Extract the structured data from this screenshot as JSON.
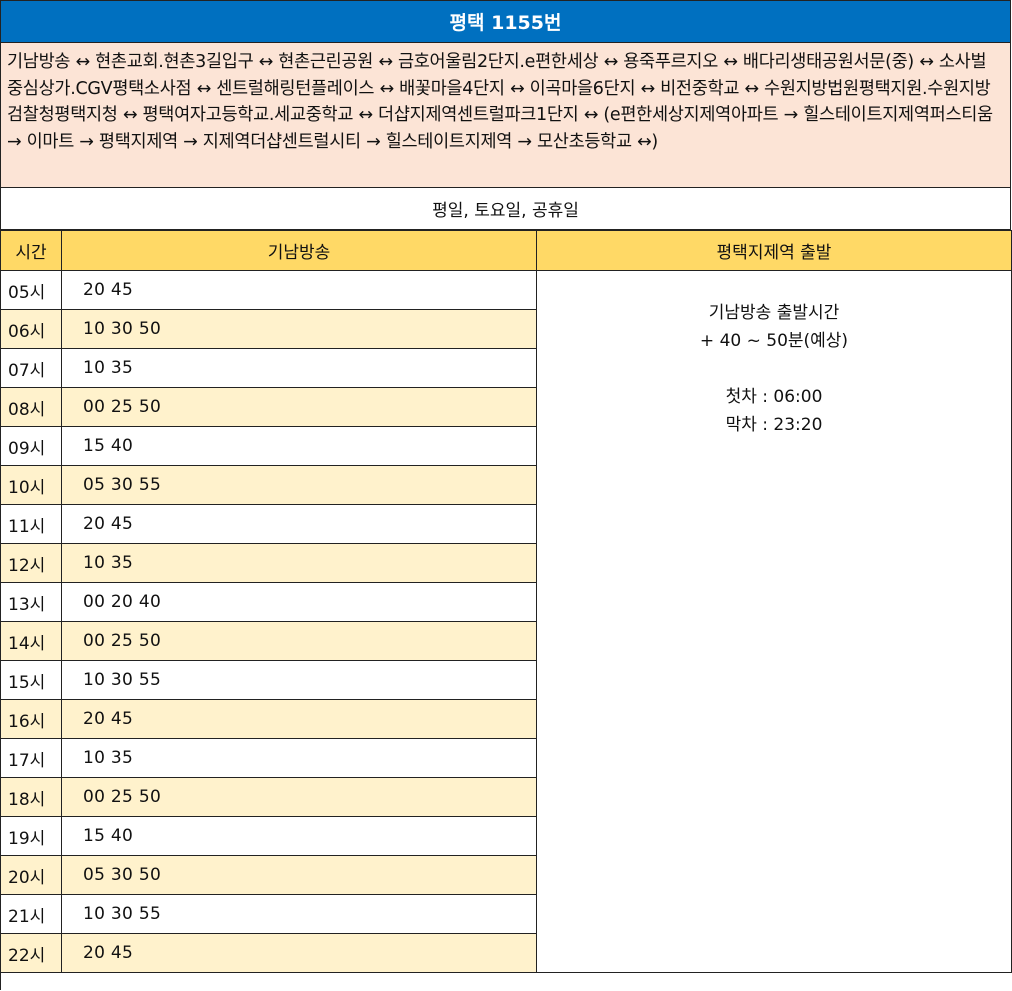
{
  "title": "평택 1155번",
  "route": "기남방송 ↔ 현촌교회.현촌3길입구 ↔ 현촌근린공원 ↔ 금호어울림2단지.e편한세상 ↔ 용죽푸르지오 ↔ 배다리생태공원서문(중) ↔ 소사벌중심상가.CGV평택소사점 ↔ 센트럴해링턴플레이스 ↔ 배꽃마을4단지 ↔ 이곡마을6단지 ↔ 비전중학교 ↔ 수원지방법원평택지원.수원지방검찰청평택지청 ↔ 평택여자고등학교.세교중학교 ↔ 더샵지제역센트럴파크1단지 ↔ (e편한세상지제역아파트 → 힐스테이트지제역퍼스티움 → 이마트 → 평택지제역 → 지제역더샵센트럴시티 → 힐스테이트지제역 → 모산초등학교 ↔)",
  "days": "평일, 토요일, 공휴일",
  "headers": {
    "hour": "시간",
    "origin": "기남방송",
    "return": "평택지제역 출발"
  },
  "rows": [
    {
      "hour": "05시",
      "mins": "20 45"
    },
    {
      "hour": "06시",
      "mins": "10 30 50"
    },
    {
      "hour": "07시",
      "mins": "10 35"
    },
    {
      "hour": "08시",
      "mins": "00 25 50"
    },
    {
      "hour": "09시",
      "mins": "15 40"
    },
    {
      "hour": "10시",
      "mins": "05 30 55"
    },
    {
      "hour": "11시",
      "mins": "20 45"
    },
    {
      "hour": "12시",
      "mins": "10 35"
    },
    {
      "hour": "13시",
      "mins": "00 20 40"
    },
    {
      "hour": "14시",
      "mins": "00 25 50"
    },
    {
      "hour": "15시",
      "mins": "10 30 55"
    },
    {
      "hour": "16시",
      "mins": "20 45"
    },
    {
      "hour": "17시",
      "mins": "10 35"
    },
    {
      "hour": "18시",
      "mins": "00 25 50"
    },
    {
      "hour": "19시",
      "mins": "15 40"
    },
    {
      "hour": "20시",
      "mins": "05 30 50"
    },
    {
      "hour": "21시",
      "mins": "10 30 55"
    },
    {
      "hour": "22시",
      "mins": "20 45"
    }
  ],
  "note": {
    "line1": "기남방송 출발시간",
    "line2": "+ 40 ~ 50분(예상)",
    "first": "첫차 : 06:00",
    "last": "막차 : 23:20"
  },
  "colors": {
    "title_bg": "#0070c0",
    "route_bg": "#fce4d6",
    "header_bg": "#ffd966",
    "alt_row_bg": "#fff2cc"
  }
}
